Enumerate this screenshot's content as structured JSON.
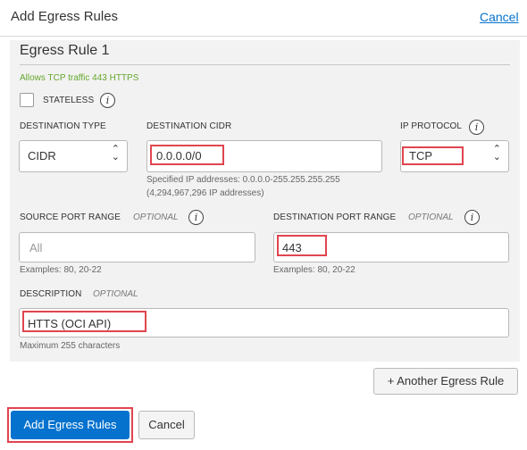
{
  "header": {
    "title": "Add Egress Rules",
    "cancel_link": "Cancel"
  },
  "rule": {
    "title": "Egress Rule 1",
    "description_note": "Allows TCP traffic 443 HTTPS",
    "stateless": {
      "label": "STATELESS",
      "checked": false
    },
    "destination_type": {
      "label": "DESTINATION TYPE",
      "value": "CIDR"
    },
    "destination_cidr": {
      "label": "DESTINATION CIDR",
      "value": "0.0.0.0/0",
      "help_line1": "Specified IP addresses: 0.0.0.0-255.255.255.255",
      "help_line2": "(4,294,967,296 IP addresses)"
    },
    "ip_protocol": {
      "label": "IP PROTOCOL",
      "value": "TCP"
    },
    "source_port_range": {
      "label": "SOURCE PORT RANGE",
      "optional": "OPTIONAL",
      "placeholder": "All",
      "help": "Examples: 80, 20-22"
    },
    "destination_port_range": {
      "label": "DESTINATION PORT RANGE",
      "optional": "OPTIONAL",
      "value": "443",
      "help": "Examples: 80, 20-22"
    },
    "description": {
      "label": "DESCRIPTION",
      "optional": "OPTIONAL",
      "value": "HTTS (OCI API)",
      "help": "Maximum 255 characters"
    }
  },
  "buttons": {
    "another_rule": "+ Another Egress Rule",
    "add_rules": "Add Egress Rules",
    "cancel": "Cancel"
  },
  "colors": {
    "primary": "#0572ce",
    "highlight": "#e0454f",
    "note_green": "#65a82f"
  }
}
